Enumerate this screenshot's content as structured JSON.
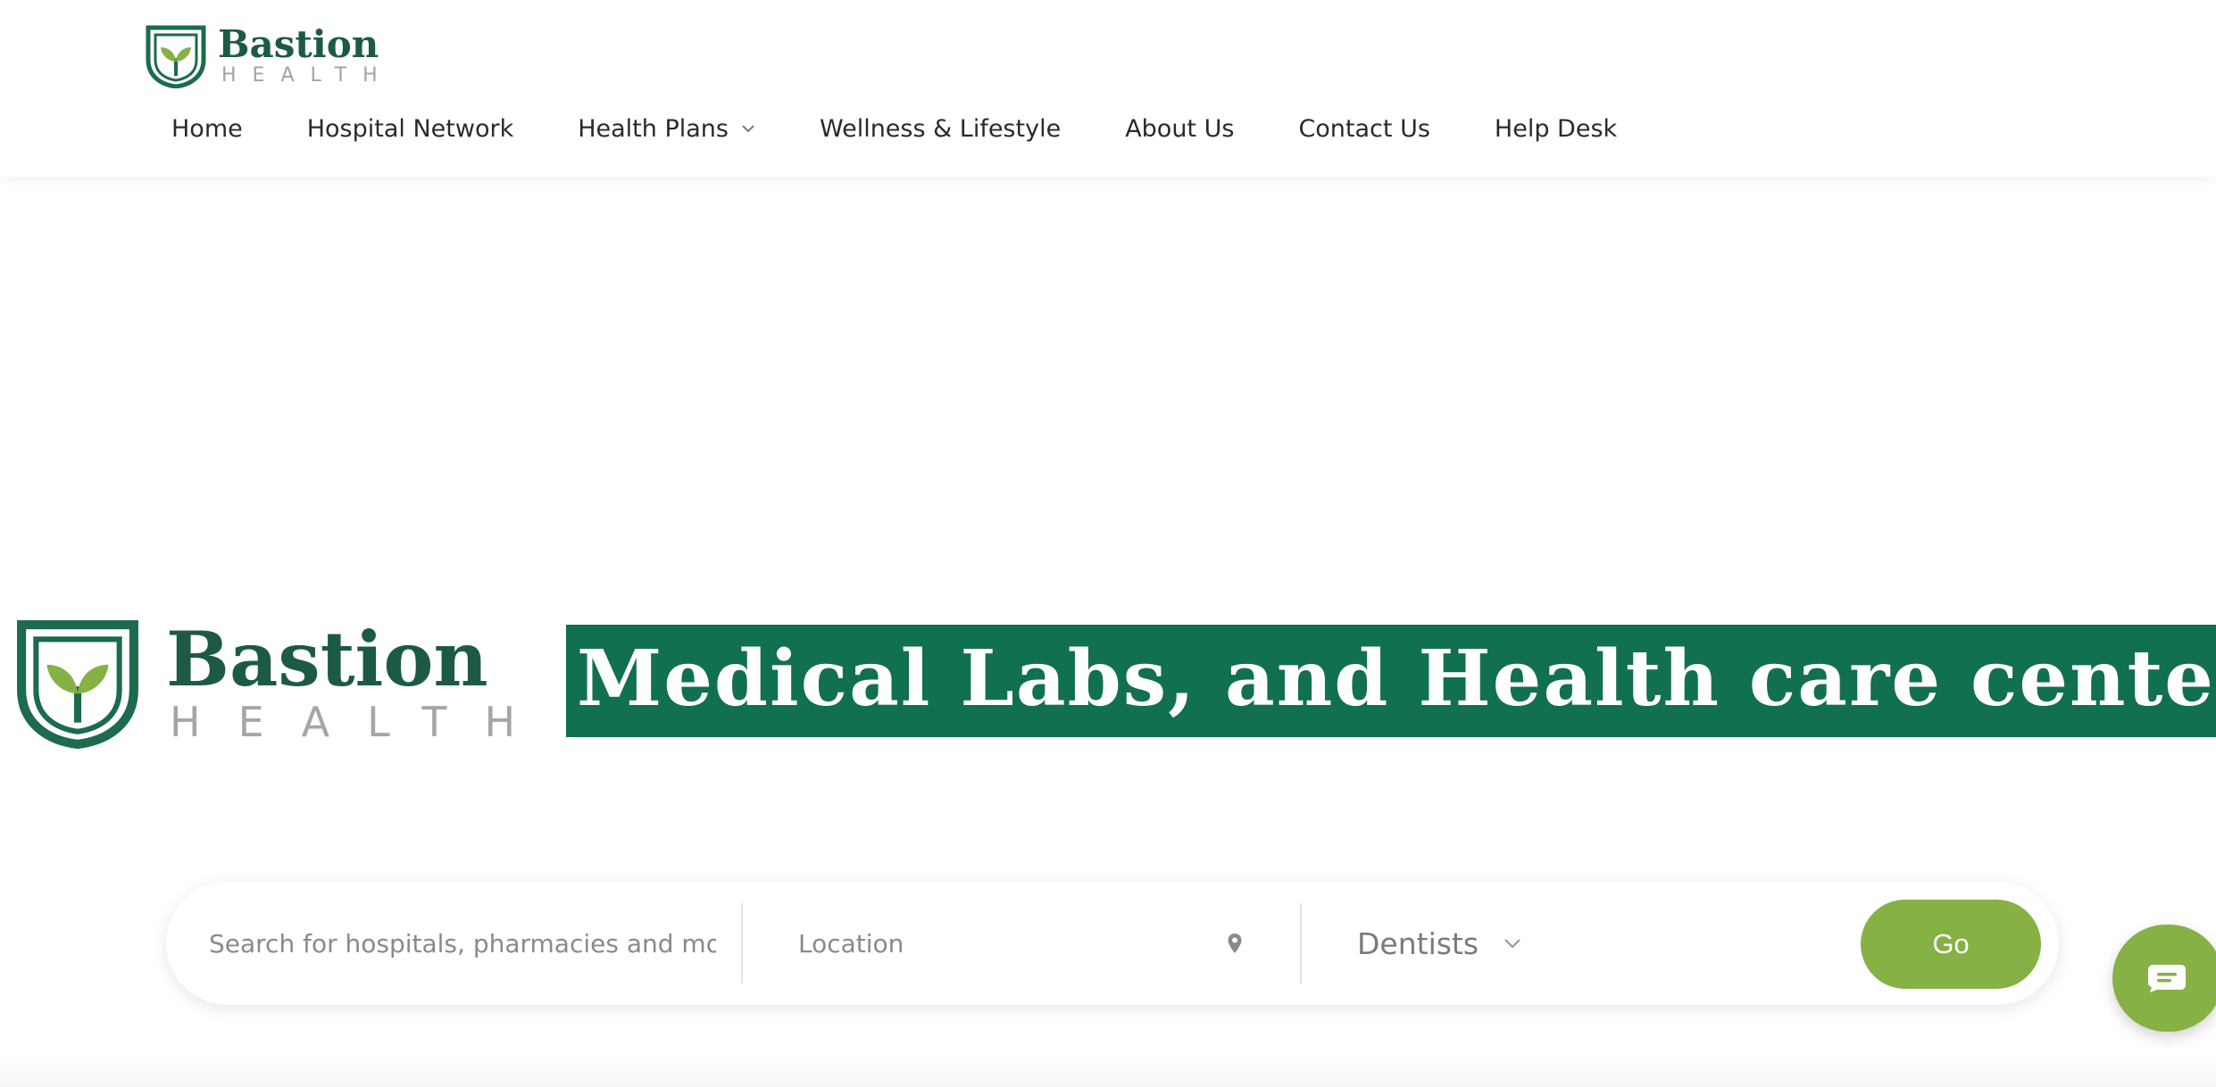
{
  "brand": {
    "name": "Bastion",
    "subtitle": "HEALTH",
    "primary_color": "#1c5a44",
    "accent_color": "#86b145"
  },
  "nav": {
    "items": [
      {
        "label": "Home"
      },
      {
        "label": "Hospital Network"
      },
      {
        "label": "Health Plans",
        "icon": "chevron-down-icon"
      },
      {
        "label": "Wellness & Lifestyle"
      },
      {
        "label": "About Us"
      },
      {
        "label": "Contact Us"
      },
      {
        "label": "Help Desk"
      }
    ]
  },
  "hero": {
    "logo_name": "Bastion",
    "logo_subtitle": "HEALTH",
    "banner_text": "Medical Labs, and Health care centers",
    "banner_color": "#11704f"
  },
  "search": {
    "query_placeholder": "Search for hospitals, pharmacies and more",
    "location_placeholder": "Location",
    "location_icon": "map-pin-icon",
    "specialty_value": "Dentists",
    "go_label": "Go"
  },
  "chat": {
    "icon": "chat-bubble-icon"
  }
}
